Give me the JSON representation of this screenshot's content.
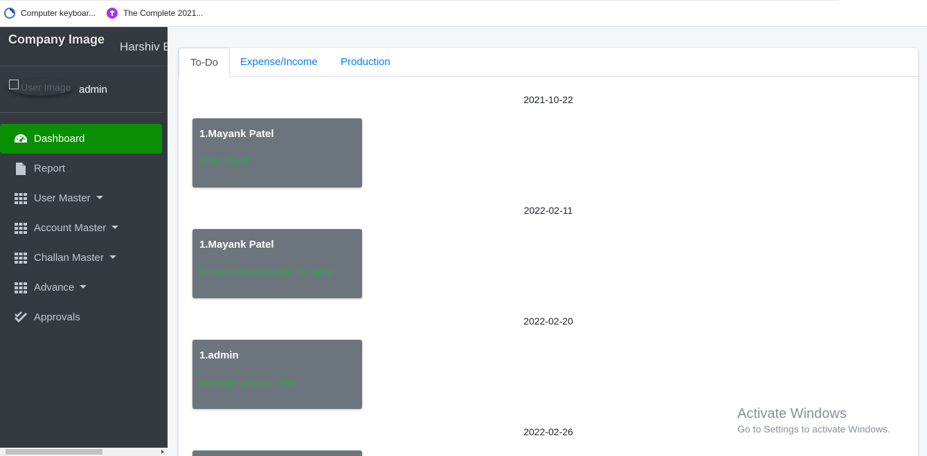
{
  "bookmarks": [
    {
      "label": "Computer keyboar...",
      "icon": "blue-swirl-icon"
    },
    {
      "label": "The Complete 2021...",
      "icon": "purple-circle-icon"
    }
  ],
  "sidebar": {
    "brand_image_alt": "Company Image",
    "brand_text": "Harshiv E",
    "user_image_alt": "User Image",
    "user_name": "admin",
    "items": [
      {
        "label": "Dashboard",
        "icon": "dashboard-icon",
        "active": true,
        "dropdown": false
      },
      {
        "label": "Report",
        "icon": "file-icon",
        "active": false,
        "dropdown": false
      },
      {
        "label": "User Master",
        "icon": "grid-icon",
        "active": false,
        "dropdown": true
      },
      {
        "label": "Account Master",
        "icon": "grid-icon",
        "active": false,
        "dropdown": true
      },
      {
        "label": "Challan Master",
        "icon": "grid-icon",
        "active": false,
        "dropdown": true
      },
      {
        "label": "Advance",
        "icon": "grid-icon",
        "active": false,
        "dropdown": true
      },
      {
        "label": "Approvals",
        "icon": "check-double-icon",
        "active": false,
        "dropdown": false
      }
    ]
  },
  "tabs": [
    {
      "label": "To-Do",
      "active": true
    },
    {
      "label": "Expense/Income",
      "active": false
    },
    {
      "label": "Production",
      "active": false
    }
  ],
  "todo_groups": [
    {
      "date": "2021-10-22",
      "name": "1.Mayank Patel",
      "note": "JCB START"
    },
    {
      "date": "2022-02-11",
      "name": "1.Mayank Patel",
      "note": "HITACHI TRANSFER TO SIDE"
    },
    {
      "date": "2022-02-20",
      "name": "1.admin",
      "note": "bill make at befor 25th"
    },
    {
      "date": "2022-02-26",
      "name": "",
      "note": ""
    }
  ],
  "watermark": {
    "line1": "Activate Windows",
    "line2": "Go to Settings to activate Windows."
  },
  "colors": {
    "sidebar_bg": "#343a40",
    "active_item": "#0a8f04",
    "card_bg": "#6c757d",
    "note_text": "#28a745",
    "tab_link": "#007bff"
  }
}
